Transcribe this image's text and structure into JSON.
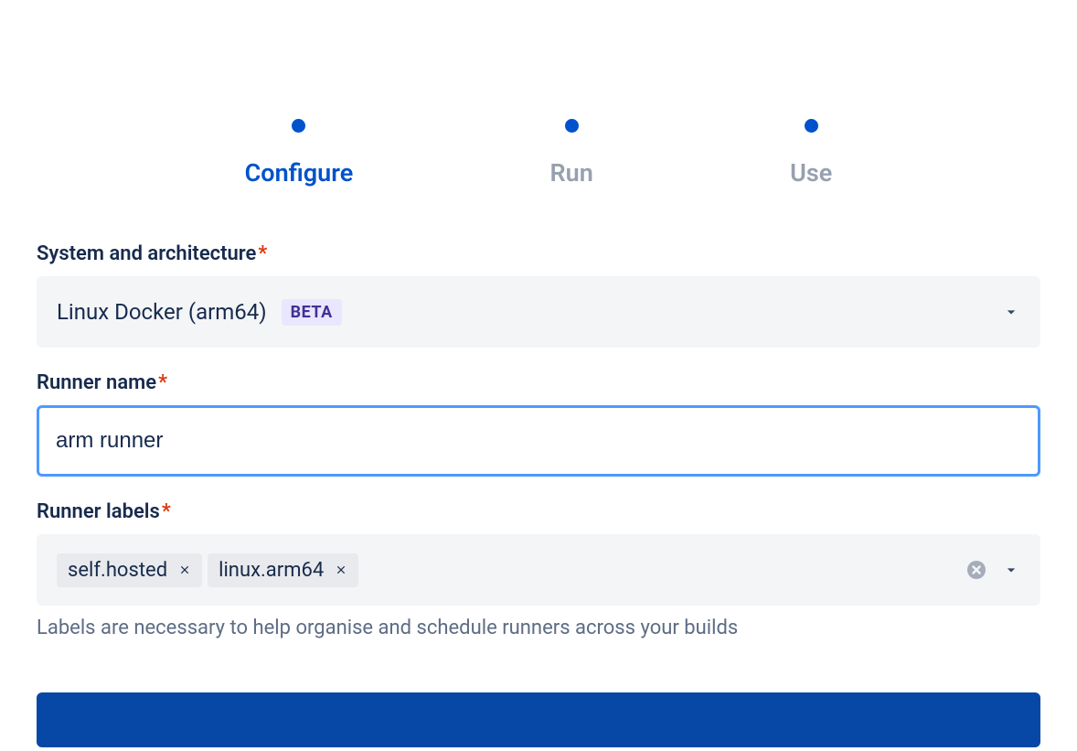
{
  "stepper": {
    "steps": [
      {
        "label": "Configure",
        "active": true
      },
      {
        "label": "Run",
        "active": false
      },
      {
        "label": "Use",
        "active": false
      }
    ]
  },
  "system": {
    "label": "System and architecture",
    "value": "Linux Docker (arm64)",
    "badge": "BETA"
  },
  "runnerName": {
    "label": "Runner name",
    "value": "arm runner"
  },
  "runnerLabels": {
    "label": "Runner labels",
    "tags": [
      {
        "text": "self.hosted"
      },
      {
        "text": "linux.arm64"
      }
    ],
    "help": "Labels are necessary to help organise and schedule runners across your builds"
  }
}
